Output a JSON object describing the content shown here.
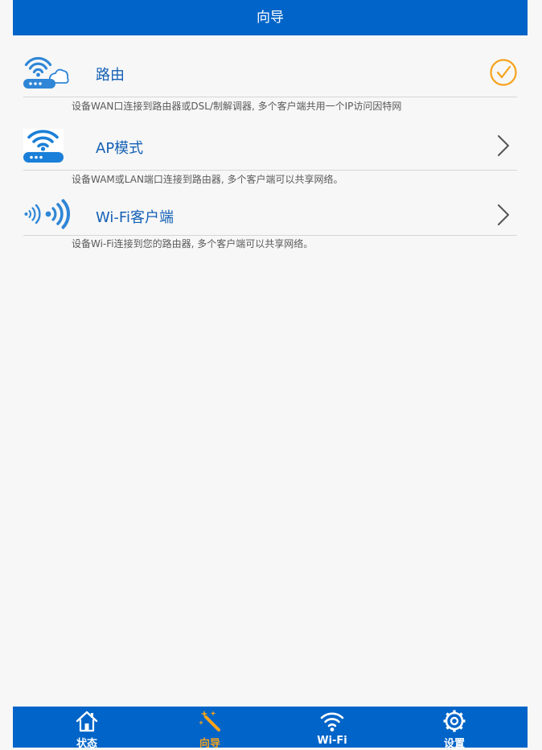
{
  "header": {
    "title": "向导"
  },
  "modes": [
    {
      "label": "路由",
      "description": "设备WAN口连接到路由器或DSL/制解调器, 多个客户端共用一个IP访问因特网",
      "icon": "router-cloud-wifi-icon",
      "indicator": "check-circle-icon",
      "selected": true
    },
    {
      "label": "AP模式",
      "description": "设备WAM或LAN端口连接到路由器, 多个客户端可以共享网络。",
      "icon": "access-point-wifi-icon",
      "indicator": "chevron-right-icon",
      "selected": false
    },
    {
      "label": "Wi-Fi客户端",
      "description": "设备Wi-Fi连接到您的路由器, 多个客户端可以共享网络。",
      "icon": "wireless-signal-icon",
      "indicator": "chevron-right-icon",
      "selected": false
    }
  ],
  "tabbar": {
    "tabs": [
      {
        "label": "状态",
        "icon": "home-icon",
        "active": false
      },
      {
        "label": "向导",
        "icon": "magic-wand-icon",
        "active": true
      },
      {
        "label": "Wi-Fi",
        "icon": "wifi-icon",
        "active": false
      },
      {
        "label": "设置",
        "icon": "gear-icon",
        "active": false
      }
    ]
  },
  "colors": {
    "brand_blue": "#0064c8",
    "accent_orange": "#f6a31b",
    "label_blue": "#1560b5",
    "background": "#f7f7f7",
    "description_gray": "#5a5a5a",
    "divider": "#d6d6d6"
  }
}
